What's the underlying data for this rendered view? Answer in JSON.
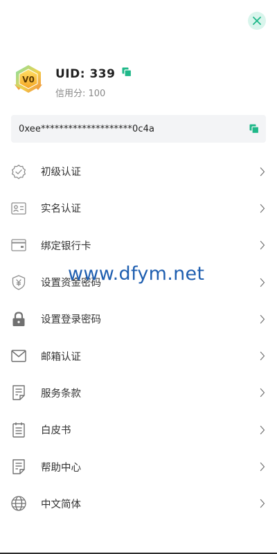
{
  "colors": {
    "accent": "#1fb889",
    "close_bg": "#d9f5ec",
    "icon_gray": "#8c8c8c",
    "watermark": "#1f5fb0"
  },
  "header": {
    "close_icon": "close-icon"
  },
  "profile": {
    "badge_text": "V0",
    "uid_label": "UID: 339",
    "credit_label": "信用分: 100",
    "copy_icon": "copy-icon"
  },
  "wallet": {
    "address": "0xee********************0c4a",
    "copy_icon": "copy-icon"
  },
  "menu": {
    "items": [
      {
        "label": "初级认证",
        "icon": "badge-check-icon"
      },
      {
        "label": "实名认证",
        "icon": "id-card-icon"
      },
      {
        "label": "绑定银行卡",
        "icon": "bank-card-icon"
      },
      {
        "label": "设置资金密码",
        "icon": "yen-shield-icon"
      },
      {
        "label": "设置登录密码",
        "icon": "lock-icon"
      },
      {
        "label": "邮箱认证",
        "icon": "mail-icon"
      },
      {
        "label": "服务条款",
        "icon": "document-icon"
      },
      {
        "label": "白皮书",
        "icon": "notebook-icon"
      },
      {
        "label": "帮助中心",
        "icon": "help-document-icon"
      },
      {
        "label": "中文简体",
        "icon": "globe-icon"
      }
    ]
  },
  "watermark": {
    "text": "www.dfym.net"
  }
}
